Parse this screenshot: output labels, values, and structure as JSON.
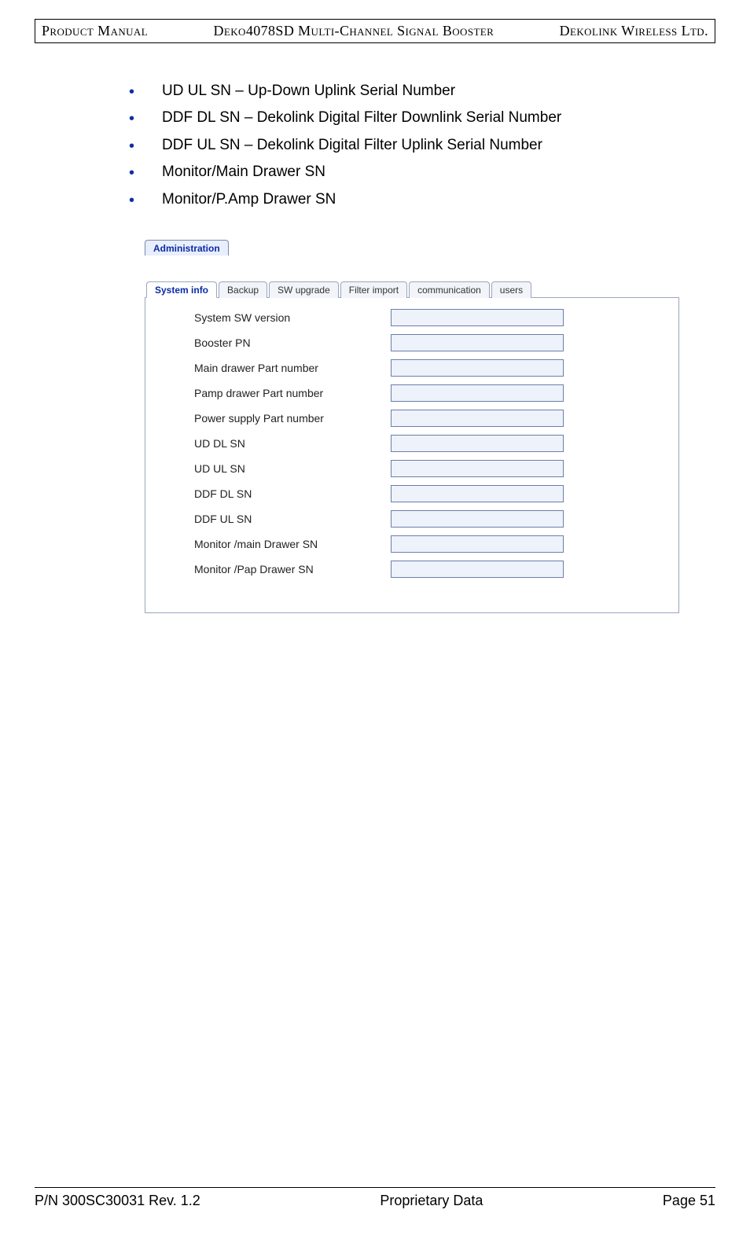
{
  "header": {
    "left": "Product Manual",
    "center": "Deko4078SD Multi-Channel Signal Booster",
    "right": "Dekolink Wireless Ltd."
  },
  "bullets": [
    "UD UL SN – Up-Down Uplink Serial Number",
    "DDF DL SN – Dekolink Digital Filter Downlink Serial Number",
    "DDF UL SN – Dekolink Digital Filter Uplink Serial Number",
    "Monitor/Main Drawer SN",
    "Monitor/P.Amp Drawer SN"
  ],
  "screenshot": {
    "adminTab": "Administration",
    "subtabs": [
      "System info",
      "Backup",
      "SW upgrade",
      "Filter import",
      "communication",
      "users"
    ],
    "activeSubtab": 0,
    "fields": [
      "System SW version",
      "Booster PN",
      "Main drawer Part number",
      "Pamp  drawer Part number",
      "Power supply Part number",
      "UD DL  SN",
      "UD UL  SN",
      "DDF DL  SN",
      "DDF UL  SN",
      "Monitor  /main Drawer  SN",
      "Monitor  /Pap Drawer  SN"
    ]
  },
  "footer": {
    "left": "P/N 300SC30031 Rev. 1.2",
    "center": "Proprietary Data",
    "right": "Page 51"
  }
}
